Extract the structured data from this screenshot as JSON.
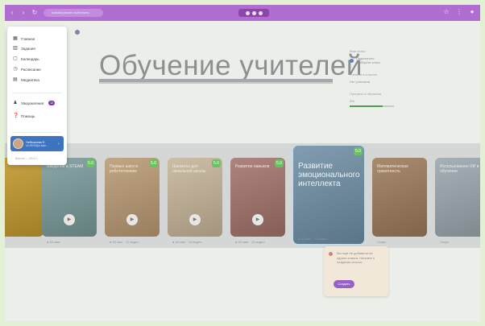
{
  "browser": {
    "url": "scholar.yandex.ru/lectures",
    "back": "‹",
    "forward": "›",
    "reload": "↻"
  },
  "page": {
    "title": "Обучение учителей"
  },
  "menu": {
    "items": [
      {
        "label": "Главная",
        "icon": "dashboard-icon",
        "glyph": "▦"
      },
      {
        "label": "Задания",
        "icon": "trash-icon",
        "glyph": "▥"
      },
      {
        "label": "Календарь",
        "icon": "calendar-icon",
        "glyph": "▢"
      },
      {
        "label": "Расписание",
        "icon": "clock-icon",
        "glyph": "◷"
      },
      {
        "label": "Медиатека",
        "icon": "media-icon",
        "glyph": "▤"
      },
      {
        "label": "Уведомления",
        "icon": "bell-icon",
        "glyph": "♟",
        "badge": "12"
      },
      {
        "label": "Помощь",
        "icon": "help-icon",
        "glyph": "❓"
      }
    ],
    "user": {
      "name": "Чебышева Е.",
      "email": "ch.9578@s.kam..."
    },
    "footer": "Версия — 2024.1"
  },
  "info_panel": {
    "label_1": "Ваш класс",
    "value_1": "Подключить",
    "sub_1": "Выберите класс",
    "label_2": "Ученики в классах",
    "sub_2": "Нет учеников",
    "label_3": "Прогресс в обучении",
    "progress_value": "0%",
    "progress_fraction": 0.75
  },
  "cards": [
    {
      "title": "",
      "rating": "",
      "meta": "",
      "color": "#c49a2e"
    },
    {
      "title": "Введение в STEAM",
      "rating": "5.0",
      "meta": "● 40 мин",
      "color": "#7a9a9a"
    },
    {
      "title": "Первые шаги в робототехнике",
      "rating": "5.0",
      "meta": "● 30 мин · 12 видео",
      "color": "#b99a74"
    },
    {
      "title": "Шахматы для начальной школы",
      "rating": "5.0",
      "meta": "● 40 мин · 10 видео",
      "color": "#c6b59a"
    },
    {
      "title": "Развитие навыков",
      "rating": "5.0",
      "meta": "● 40 мин · 10 видео",
      "color": "#a3736c"
    },
    {
      "title": "Развитие эмоционального интеллекта",
      "rating": "5.0",
      "meta": "● 50 мин · 10 видео",
      "color": "#6f8fa5"
    },
    {
      "title": "Математическая грамотность",
      "rating": "",
      "meta": "Скоро",
      "color": "#9c7b5b"
    },
    {
      "title": "Использование ИИ в обучении",
      "rating": "",
      "meta": "Скоро",
      "color": "#9aa6ad"
    }
  ],
  "tooltip": {
    "text": "Вы ещё не добавили ни одного класса. Начните с создания класса.",
    "button": "Создать"
  }
}
